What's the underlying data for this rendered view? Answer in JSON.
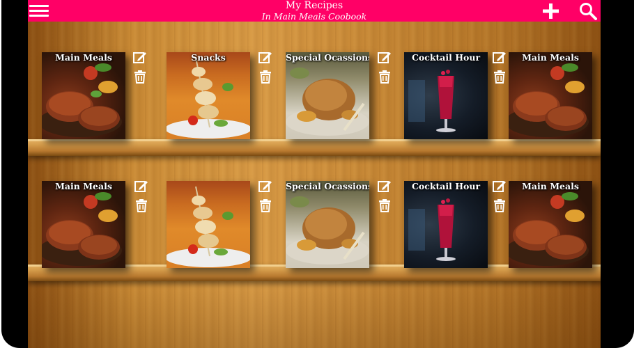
{
  "app": {
    "title": "My Recipes",
    "subtitle": "In Main Meals Coobook",
    "accent_color": "#ff0066"
  },
  "toolbar": {
    "menu_icon": "hamburger-menu-icon",
    "add_icon": "plus-icon",
    "search_icon": "search-icon"
  },
  "shelves": [
    {
      "books": [
        {
          "label": "Main Meals",
          "image": "steak"
        },
        {
          "label": "Snacks",
          "image": "kebab-skewer"
        },
        {
          "label": "Special Ocassions",
          "image": "roast-chicken"
        },
        {
          "label": "Cocktail Hour",
          "image": "red-cocktail"
        },
        {
          "label": "Main Meals",
          "image": "steak"
        }
      ]
    },
    {
      "books": [
        {
          "label": "Main Meals",
          "image": "steak"
        },
        {
          "label": "",
          "image": "kebab-skewer"
        },
        {
          "label": "Special Ocassions",
          "image": "roast-chicken"
        },
        {
          "label": "Cocktail Hour",
          "image": "red-cocktail"
        },
        {
          "label": "Main Meals",
          "image": "steak"
        }
      ]
    }
  ],
  "book_actions": {
    "edit_icon": "edit-icon",
    "delete_icon": "trash-icon"
  }
}
